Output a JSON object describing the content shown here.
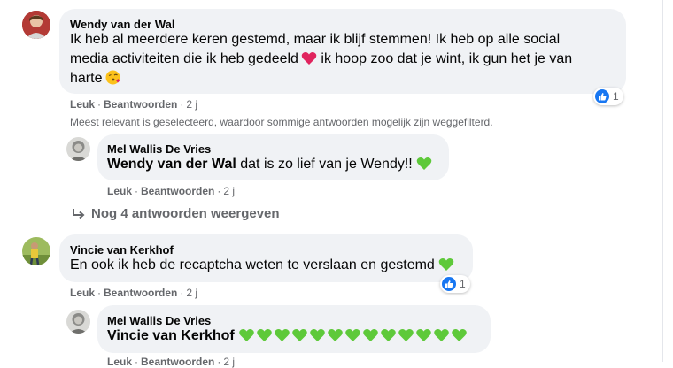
{
  "comments": [
    {
      "author": "Wendy van der Wal",
      "lines": [
        "Ik heb al meerdere keren gestemd, maar ik blijf stemmen! Ik heb op alle social",
        "media activiteiten die ik heb gedeeld",
        " ik hoop zoo dat je wint, ik gun het je van",
        "harte"
      ],
      "actions": {
        "like": "Leuk",
        "reply": "Beantwoorden",
        "time": "2 j"
      },
      "reactions": {
        "icon": "like-icon",
        "count": "1"
      },
      "filter_note": "Meest relevant is geselecteerd, waardoor sommige antwoorden mogelijk zijn weggefilterd.",
      "reply": {
        "author": "Mel Wallis De Vries",
        "mention": "Wendy van der Wal",
        "text": " dat is zo lief van je Wendy!!",
        "actions": {
          "like": "Leuk",
          "reply": "Beantwoorden",
          "time": "2 j"
        }
      },
      "more_replies": "Nog 4 antwoorden weergeven"
    },
    {
      "author": "Vincie van Kerkhof",
      "text": "En ook ik heb de recaptcha weten te verslaan en gestemd",
      "actions": {
        "like": "Leuk",
        "reply": "Beantwoorden",
        "time": "2 j"
      },
      "reactions": {
        "icon": "like-icon",
        "count": "1"
      },
      "reply": {
        "author": "Mel Wallis De Vries",
        "mention": "Vincie van Kerkhof",
        "green_hearts": 13,
        "actions": {
          "like": "Leuk",
          "reply": "Beantwoorden",
          "time": "2 j"
        }
      }
    }
  ],
  "colors": {
    "like_blue": "#1877f2",
    "bubble": "#f0f2f5",
    "meta_gray": "#65676b",
    "heart_red": "#e0245e",
    "heart_green": "#5ec93a"
  },
  "icons": {
    "red_heart": "heart-emoji",
    "kiss": "kiss-emoji",
    "green_heart": "green-heart-emoji",
    "reply_arrow": "reply-arrow-icon"
  }
}
